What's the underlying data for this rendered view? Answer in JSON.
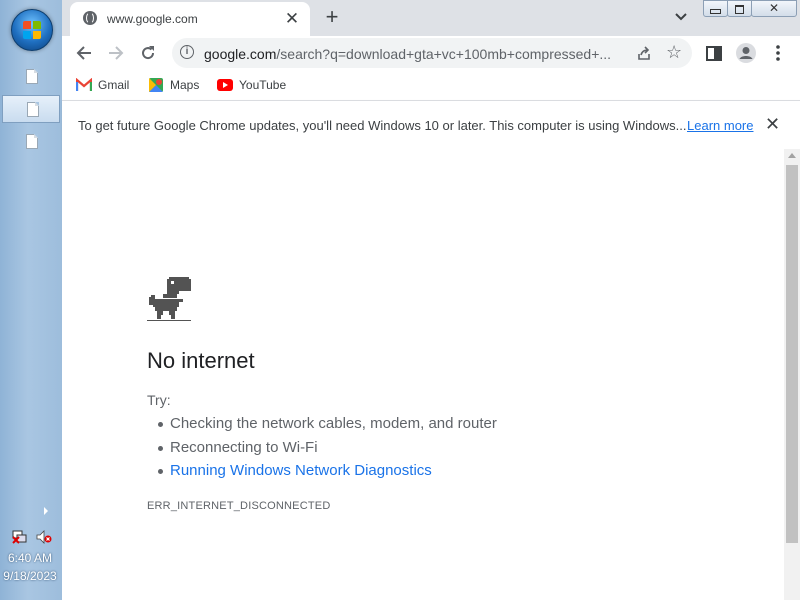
{
  "taskbar": {
    "clock_time": "6:40 AM",
    "clock_date": "9/18/2023"
  },
  "tab": {
    "title": "www.google.com",
    "favicon": "globe-icon"
  },
  "toolbar": {
    "url_host": "google.com",
    "url_rest": "/search?q=download+gta+vc+100mb+compressed+..."
  },
  "bookmarks": [
    {
      "label": "Gmail",
      "icon": "gmail-icon"
    },
    {
      "label": "Maps",
      "icon": "maps-icon"
    },
    {
      "label": "YouTube",
      "icon": "youtube-icon"
    }
  ],
  "infobar": {
    "message": "To get future Google Chrome updates, you'll need Windows 10 or later. This computer is using Windows...",
    "link": "Learn more"
  },
  "error_page": {
    "title": "No internet",
    "try_label": "Try:",
    "suggestions": [
      "Checking the network cables, modem, and router",
      "Reconnecting to Wi-Fi",
      "Running Windows Network Diagnostics"
    ],
    "error_code": "ERR_INTERNET_DISCONNECTED"
  },
  "colors": {
    "link": "#1a73e8",
    "tabstrip": "#dee1e6",
    "taskbar": "#a9c6e2"
  }
}
